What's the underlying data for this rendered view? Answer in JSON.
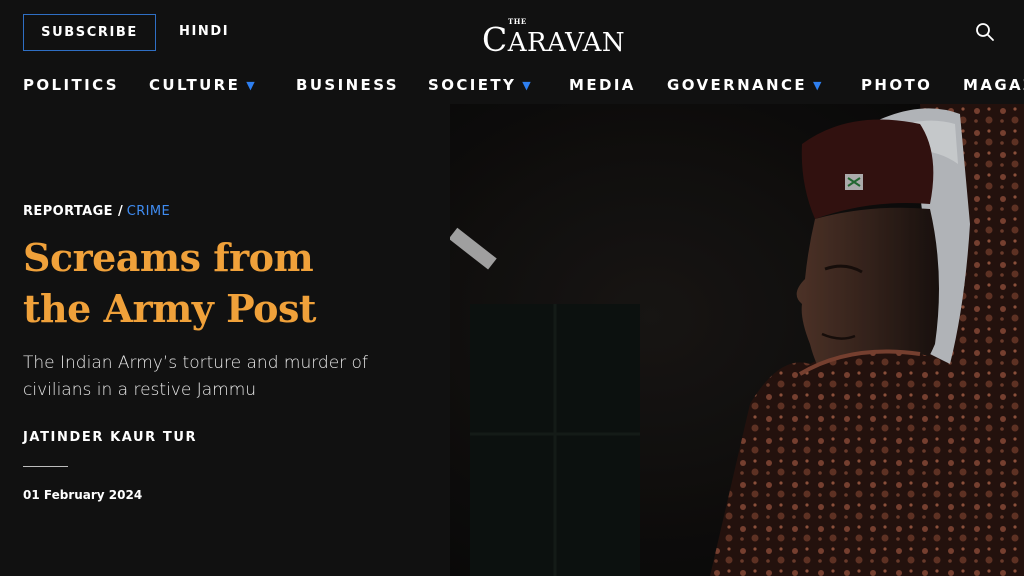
{
  "header": {
    "subscribe_label": "SUBSCRIBE",
    "hindi_label": "HINDI",
    "logo_small": "THE",
    "logo_first": "C",
    "logo_rest": "ARAVAN",
    "search_icon": "search-icon"
  },
  "nav": {
    "items": [
      {
        "label": "POLITICS",
        "has_dropdown": false
      },
      {
        "label": "CULTURE",
        "has_dropdown": true
      },
      {
        "label": "BUSINESS",
        "has_dropdown": false
      },
      {
        "label": "SOCIETY",
        "has_dropdown": true
      },
      {
        "label": "MEDIA",
        "has_dropdown": false
      },
      {
        "label": "GOVERNANCE",
        "has_dropdown": true
      },
      {
        "label": "PHOTO",
        "has_dropdown": false
      },
      {
        "label": "MAGAZ",
        "has_dropdown": false
      }
    ],
    "caret": "▼"
  },
  "article": {
    "section": "REPORTAGE",
    "separator": "/",
    "subsection": "CRIME",
    "headline_line1": "Screams from",
    "headline_line2": "the Army Post",
    "dek_line1": "The Indian Army’s torture and murder of",
    "dek_line2": "civilians in a restive Jammu",
    "author": "JATINDER KAUR TUR",
    "date": "01 February 2024"
  },
  "colors": {
    "background": "#111111",
    "headline": "#f0a13a",
    "accent_blue": "#3f8cf2",
    "subscribe_border": "#2f6fc4"
  }
}
